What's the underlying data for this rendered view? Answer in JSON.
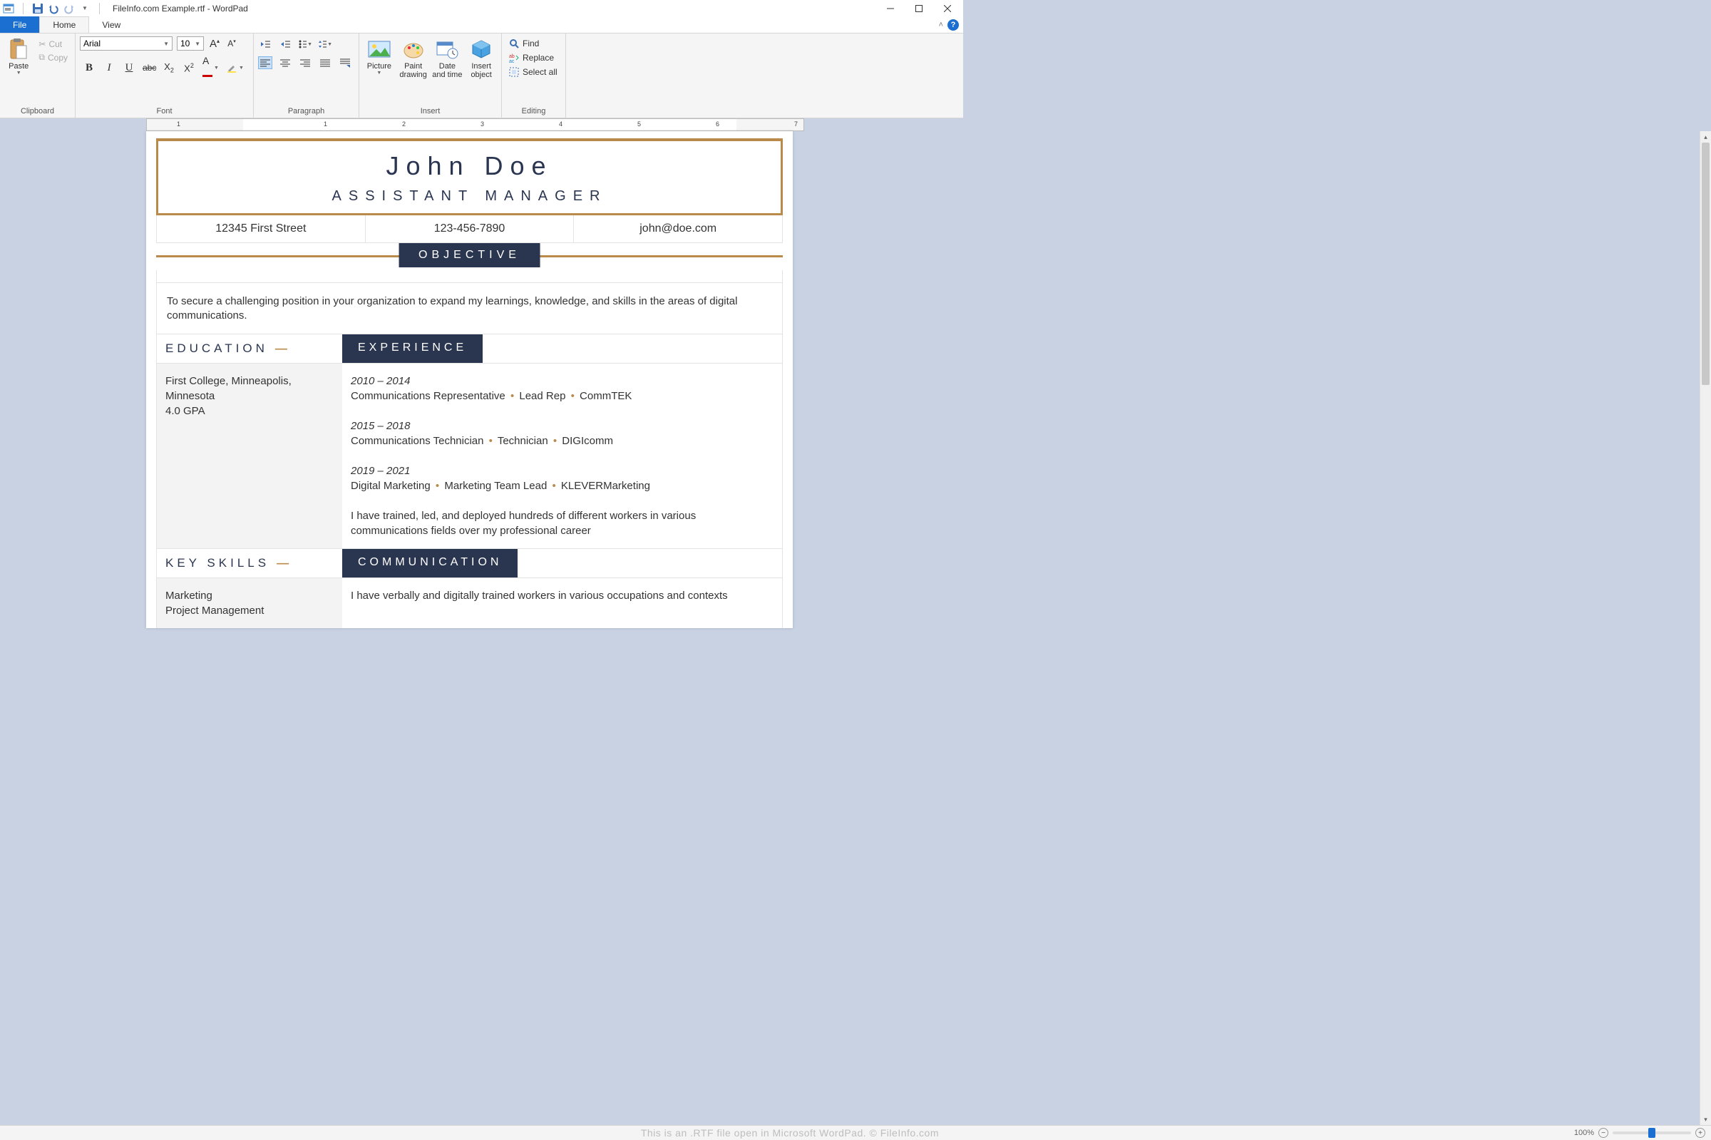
{
  "titlebar": {
    "title": "FileInfo.com Example.rtf - WordPad"
  },
  "tabs": {
    "file": "File",
    "home": "Home",
    "view": "View"
  },
  "ribbon": {
    "clipboard": {
      "label": "Clipboard",
      "paste": "Paste",
      "cut": "Cut",
      "copy": "Copy"
    },
    "font": {
      "label": "Font",
      "name": "Arial",
      "size": "10"
    },
    "paragraph": {
      "label": "Paragraph"
    },
    "insert": {
      "label": "Insert",
      "picture": "Picture",
      "paint": "Paint drawing",
      "datetime": "Date and time",
      "object": "Insert object"
    },
    "editing": {
      "label": "Editing",
      "find": "Find",
      "replace": "Replace",
      "selectall": "Select all"
    }
  },
  "ruler": {
    "marks": [
      "1",
      "1",
      "2",
      "3",
      "4",
      "5",
      "6",
      "7"
    ]
  },
  "doc": {
    "name": "John Doe",
    "title": "ASSISTANT MANAGER",
    "address": "12345 First Street",
    "phone": "123-456-7890",
    "email": "john@doe.com",
    "objective_label": "OBJECTIVE",
    "objective_text": "To secure a challenging position in your organization to expand my learnings, knowledge, and skills in the areas of digital communications.",
    "education_label": "EDUCATION",
    "experience_label": "EXPERIENCE",
    "education_body": "First College, Minneapolis, Minnesota\n4.0 GPA",
    "exp1_date": "2010 – 2014",
    "exp1_line": "Communications Representative • Lead Rep • CommTEK",
    "exp2_date": "2015 – 2018",
    "exp2_line": "Communications Technician • Technician • DIGIcomm",
    "exp3_date": "2019 – 2021",
    "exp3_line": "Digital Marketing • Marketing Team Lead • KLEVERMarketing",
    "exp_summary": "I have trained, led, and deployed hundreds of different workers in various communications fields over my professional career",
    "keyskills_label": "KEY SKILLS",
    "communication_label": "COMMUNICATION",
    "skills_body": "Marketing\nProject Management",
    "comm_body": "I have verbally and digitally trained workers in various occupations and contexts"
  },
  "status": {
    "watermark": "This is an .RTF file open in Microsoft WordPad. © FileInfo.com",
    "zoom": "100%"
  }
}
